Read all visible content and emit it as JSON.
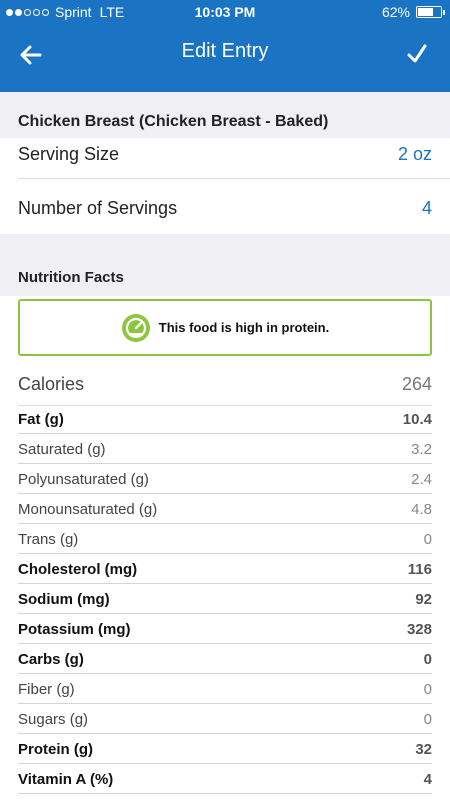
{
  "status_bar": {
    "carrier": "Sprint",
    "network": "LTE",
    "time": "10:03 PM",
    "battery": "62%",
    "battery_level": 0.62,
    "signal_bars": 2,
    "signal_total": 5
  },
  "nav": {
    "title": "Edit Entry",
    "back_icon": "arrow-left-icon",
    "confirm_icon": "checkmark-icon",
    "color": "#1a73c3"
  },
  "food": {
    "name": "Chicken Breast (Chicken Breast - Baked)",
    "serving_size_label": "Serving Size",
    "serving_size_value": "2 oz",
    "servings_label": "Number of Servings",
    "servings_value": "4"
  },
  "nutrition": {
    "header": "Nutrition Facts",
    "badge_text": "This food is high in protein.",
    "badge_icon": "gauge-icon",
    "badge_color": "#8cc63f",
    "calories_label": "Calories",
    "calories_value": "264",
    "rows": [
      {
        "label": "Fat (g)",
        "value": "10.4",
        "bold": true
      },
      {
        "label": "Saturated (g)",
        "value": "3.2",
        "bold": false
      },
      {
        "label": "Polyunsaturated (g)",
        "value": "2.4",
        "bold": false
      },
      {
        "label": "Monounsaturated (g)",
        "value": "4.8",
        "bold": false
      },
      {
        "label": "Trans (g)",
        "value": "0",
        "bold": false
      },
      {
        "label": "Cholesterol (mg)",
        "value": "116",
        "bold": true
      },
      {
        "label": "Sodium (mg)",
        "value": "92",
        "bold": true
      },
      {
        "label": "Potassium (mg)",
        "value": "328",
        "bold": true
      },
      {
        "label": "Carbs (g)",
        "value": "0",
        "bold": true
      },
      {
        "label": "Fiber (g)",
        "value": "0",
        "bold": false
      },
      {
        "label": "Sugars (g)",
        "value": "0",
        "bold": false
      },
      {
        "label": "Protein (g)",
        "value": "32",
        "bold": true
      },
      {
        "label": "Vitamin A (%)",
        "value": "4",
        "bold": true
      }
    ]
  }
}
